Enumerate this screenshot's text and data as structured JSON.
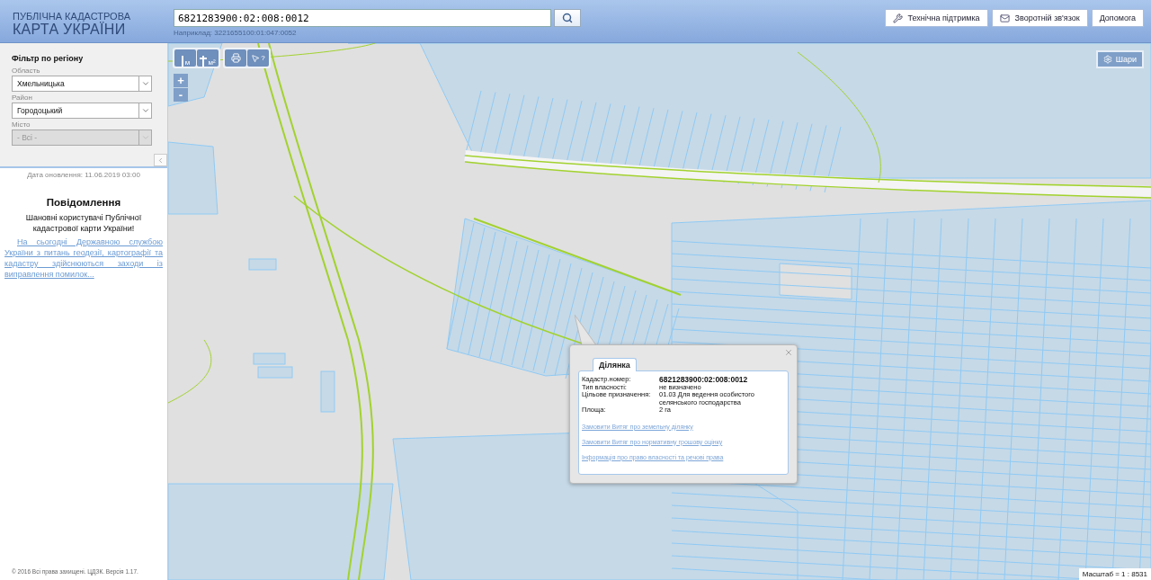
{
  "header": {
    "logo_line1": "ПУБЛІЧНА КАДАСТРОВА",
    "logo_line2": "КАРТА УКРАЇНИ",
    "search": {
      "value": "6821283900:02:008:0012",
      "hint": "Наприклад: 3221655100:01:047:0052"
    },
    "buttons": [
      {
        "label": "Технічна підтримка",
        "kind": "support"
      },
      {
        "label": "Зворотній зв'язок",
        "kind": "mail"
      },
      {
        "label": "Допомога",
        "kind": "plain"
      }
    ]
  },
  "filter": {
    "title": "Фільтр по регіону",
    "fields": [
      {
        "label": "Область",
        "value": "Хмельницька",
        "disabled": false
      },
      {
        "label": "Район",
        "value": "Городоцький",
        "disabled": false
      },
      {
        "label": "Місто",
        "value": "- Всі -",
        "disabled": true
      }
    ]
  },
  "update_date": "Дата оновлення: 11.06.2019 03:00",
  "notice": {
    "title": "Повідомлення",
    "greeting": "Шановні користувачі Публічної кадастрової карти України!",
    "link": "На сьогодні Державною службою України з питань геодезії, картографії та кадастру здійснюються заходи із виправлення помилок..."
  },
  "copyright": "© 2016 Всі права захищені. ЦДЗК. Версія 1.17.",
  "map": {
    "tools": [
      {
        "kind": "distance",
        "sub": "м"
      },
      {
        "kind": "area",
        "sub": "м²"
      },
      {
        "kind": "print"
      },
      {
        "kind": "identify",
        "sub": "?"
      }
    ],
    "zoom": [
      "+",
      "-"
    ],
    "layers_button": "Шари",
    "popup": {
      "tab": "Ділянка",
      "rows": [
        {
          "label": "Кадастр.номер:",
          "value": "6821283900:02:008:0012",
          "bold": true
        },
        {
          "label": "Тип власності:",
          "value": "не визначено",
          "bold": false
        },
        {
          "label": "Цільове призначення:",
          "value": "01.03 Для ведення особистого селянського господарства",
          "bold": false
        },
        {
          "label": "Площа:",
          "value": "2 га",
          "bold": false
        }
      ],
      "links": [
        "Замовити Витяг про земельну ділянку",
        "Замовити Витяг про нормативну грошову оцінку",
        "Інформація про право власності та речові права"
      ]
    },
    "scale": "Масштаб = 1 : 8531"
  }
}
